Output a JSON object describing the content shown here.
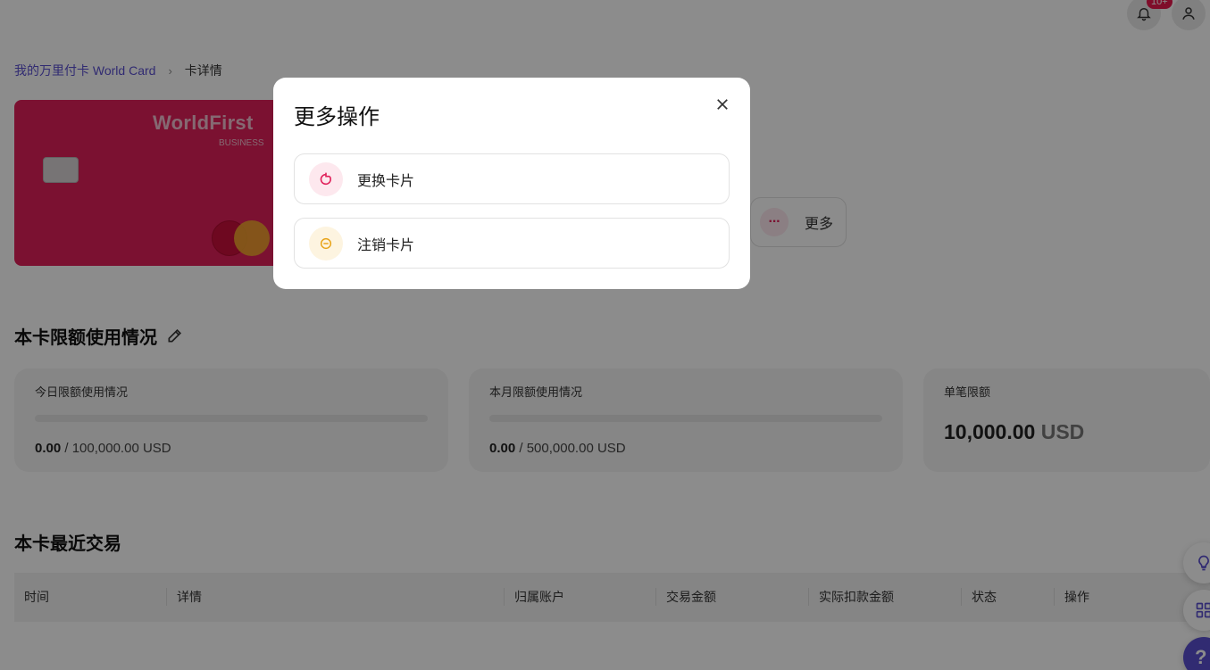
{
  "header": {
    "notification_badge": "10+",
    "bell_icon": "bell-icon",
    "user_icon": "user-icon"
  },
  "breadcrumb": {
    "parent": "我的万里付卡 World Card",
    "separator": "›",
    "current": "卡详情"
  },
  "card": {
    "brand": "WorldFirst",
    "subtitle": "BUSINESS",
    "color": "#e0205a"
  },
  "actions": {
    "more_label": "更多",
    "more_icon": "more-dots-icon"
  },
  "limits": {
    "title": "本卡限额使用情况",
    "daily": {
      "label": "今日限额使用情况",
      "used": "0.00",
      "total": "/ 100,000.00 USD",
      "fraction": 0
    },
    "monthly": {
      "label": "本月限额使用情况",
      "used": "0.00",
      "total": "/ 500,000.00 USD",
      "fraction": 0
    },
    "single": {
      "label": "单笔限额",
      "amount": "10,000.00",
      "currency": "USD"
    }
  },
  "transactions": {
    "title": "本卡最近交易",
    "columns": [
      "时间",
      "详情",
      "归属账户",
      "交易金额",
      "实际扣款金额",
      "状态",
      "操作"
    ]
  },
  "modal": {
    "title": "更多操作",
    "options": [
      {
        "label": "更换卡片",
        "icon": "refresh-icon",
        "color": "#e0205a",
        "bg": "#fde8ee"
      },
      {
        "label": "注销卡片",
        "icon": "minus-circle-icon",
        "color": "#e8a317",
        "bg": "#fdf4e0"
      }
    ]
  },
  "floating": {
    "tips_icon": "lightbulb-icon",
    "apps_icon": "grid-icon",
    "help_label": "?"
  }
}
